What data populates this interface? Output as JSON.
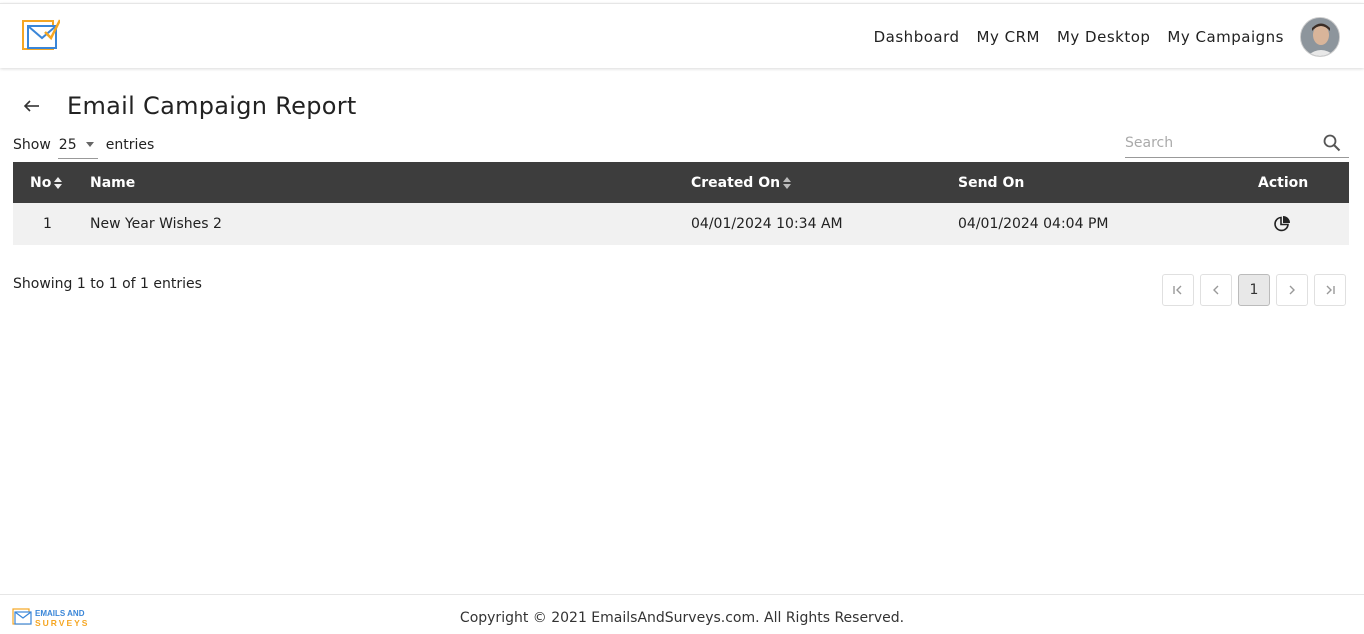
{
  "header": {
    "logo_icon": "envelope-check-logo-icon",
    "nav": [
      "Dashboard",
      "My CRM",
      "My Desktop",
      "My Campaigns"
    ],
    "avatar_icon": "user-avatar"
  },
  "page": {
    "title": "Email Campaign Report",
    "back_icon": "arrow-left-icon"
  },
  "entries": {
    "show_label": "Show",
    "value": "25",
    "suffix_label": "entries"
  },
  "search": {
    "placeholder": "Search",
    "value": ""
  },
  "table": {
    "columns": {
      "no": "No",
      "name": "Name",
      "created_on": "Created On",
      "send_on": "Send On",
      "action": "Action"
    },
    "rows": [
      {
        "no": "1",
        "name": "New Year Wishes 2",
        "created_on": "04/01/2024 10:34 AM",
        "send_on": "04/01/2024 04:04 PM",
        "action_icon": "pie-chart-report-icon"
      }
    ]
  },
  "info": "Showing 1 to 1 of 1 entries",
  "pagination": {
    "current_page": "1"
  },
  "footer": {
    "logo_text_1": "EMAILS AND",
    "logo_text_2": "SURVEYS",
    "copyright": "Copyright © 2021 EmailsAndSurveys.com. All Rights Reserved."
  },
  "colors": {
    "table_header_bg": "#3d3d3d",
    "row_bg": "#f1f1f1",
    "logo_orange": "#f5a623",
    "logo_blue": "#3a86d8"
  }
}
